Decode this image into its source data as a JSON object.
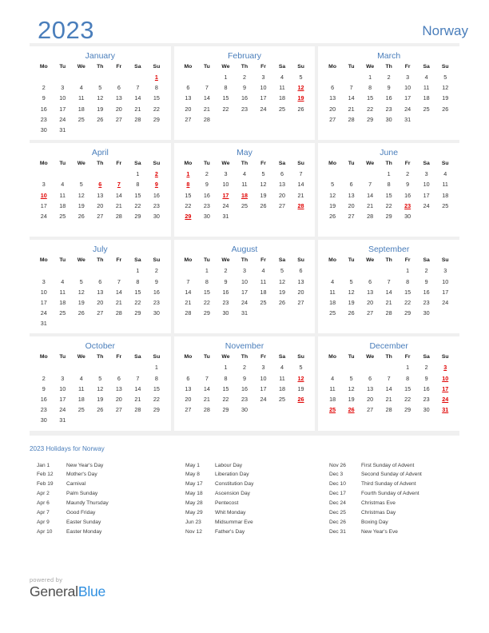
{
  "header": {
    "year": "2023",
    "country": "Norway"
  },
  "months": [
    {
      "name": "January",
      "weekdays": [
        "Mo",
        "Tu",
        "We",
        "Th",
        "Fr",
        "Sa",
        "Su"
      ],
      "weeks": [
        [
          "",
          "",
          "",
          "",
          "",
          "",
          "1"
        ],
        [
          "2",
          "3",
          "4",
          "5",
          "6",
          "7",
          "8"
        ],
        [
          "9",
          "10",
          "11",
          "12",
          "13",
          "14",
          "15"
        ],
        [
          "16",
          "17",
          "18",
          "19",
          "20",
          "21",
          "22"
        ],
        [
          "23",
          "24",
          "25",
          "26",
          "27",
          "28",
          "29"
        ],
        [
          "30",
          "31",
          "",
          "",
          "",
          "",
          ""
        ]
      ],
      "holidays": [
        1
      ]
    },
    {
      "name": "February",
      "weekdays": [
        "Mo",
        "Tu",
        "We",
        "Th",
        "Fr",
        "Sa",
        "Su"
      ],
      "weeks": [
        [
          "",
          "",
          "1",
          "2",
          "3",
          "4",
          "5"
        ],
        [
          "6",
          "7",
          "8",
          "9",
          "10",
          "11",
          "12"
        ],
        [
          "13",
          "14",
          "15",
          "16",
          "17",
          "18",
          "19"
        ],
        [
          "20",
          "21",
          "22",
          "23",
          "24",
          "25",
          "26"
        ],
        [
          "27",
          "28",
          "",
          "",
          "",
          "",
          ""
        ],
        [
          "",
          "",
          "",
          "",
          "",
          "",
          ""
        ]
      ],
      "holidays": [
        12,
        19
      ]
    },
    {
      "name": "March",
      "weekdays": [
        "Mo",
        "Tu",
        "We",
        "Th",
        "Fr",
        "Sa",
        "Su"
      ],
      "weeks": [
        [
          "",
          "",
          "1",
          "2",
          "3",
          "4",
          "5"
        ],
        [
          "6",
          "7",
          "8",
          "9",
          "10",
          "11",
          "12"
        ],
        [
          "13",
          "14",
          "15",
          "16",
          "17",
          "18",
          "19"
        ],
        [
          "20",
          "21",
          "22",
          "23",
          "24",
          "25",
          "26"
        ],
        [
          "27",
          "28",
          "29",
          "30",
          "31",
          "",
          ""
        ],
        [
          "",
          "",
          "",
          "",
          "",
          "",
          ""
        ]
      ],
      "holidays": []
    },
    {
      "name": "April",
      "weekdays": [
        "Mo",
        "Tu",
        "We",
        "Th",
        "Fr",
        "Sa",
        "Su"
      ],
      "weeks": [
        [
          "",
          "",
          "",
          "",
          "",
          "1",
          "2"
        ],
        [
          "3",
          "4",
          "5",
          "6",
          "7",
          "8",
          "9"
        ],
        [
          "10",
          "11",
          "12",
          "13",
          "14",
          "15",
          "16"
        ],
        [
          "17",
          "18",
          "19",
          "20",
          "21",
          "22",
          "23"
        ],
        [
          "24",
          "25",
          "26",
          "27",
          "28",
          "29",
          "30"
        ],
        [
          "",
          "",
          "",
          "",
          "",
          "",
          ""
        ]
      ],
      "holidays": [
        2,
        6,
        7,
        9,
        10
      ]
    },
    {
      "name": "May",
      "weekdays": [
        "Mo",
        "Tu",
        "We",
        "Th",
        "Fr",
        "Sa",
        "Su"
      ],
      "weeks": [
        [
          "1",
          "2",
          "3",
          "4",
          "5",
          "6",
          "7"
        ],
        [
          "8",
          "9",
          "10",
          "11",
          "12",
          "13",
          "14"
        ],
        [
          "15",
          "16",
          "17",
          "18",
          "19",
          "20",
          "21"
        ],
        [
          "22",
          "23",
          "24",
          "25",
          "26",
          "27",
          "28"
        ],
        [
          "29",
          "30",
          "31",
          "",
          "",
          "",
          ""
        ],
        [
          "",
          "",
          "",
          "",
          "",
          "",
          ""
        ]
      ],
      "holidays": [
        1,
        8,
        17,
        18,
        28,
        29
      ]
    },
    {
      "name": "June",
      "weekdays": [
        "Mo",
        "Tu",
        "We",
        "Th",
        "Fr",
        "Sa",
        "Su"
      ],
      "weeks": [
        [
          "",
          "",
          "",
          "1",
          "2",
          "3",
          "4"
        ],
        [
          "5",
          "6",
          "7",
          "8",
          "9",
          "10",
          "11"
        ],
        [
          "12",
          "13",
          "14",
          "15",
          "16",
          "17",
          "18"
        ],
        [
          "19",
          "20",
          "21",
          "22",
          "23",
          "24",
          "25"
        ],
        [
          "26",
          "27",
          "28",
          "29",
          "30",
          "",
          ""
        ],
        [
          "",
          "",
          "",
          "",
          "",
          "",
          ""
        ]
      ],
      "holidays": [
        23
      ]
    },
    {
      "name": "July",
      "weekdays": [
        "Mo",
        "Tu",
        "We",
        "Th",
        "Fr",
        "Sa",
        "Su"
      ],
      "weeks": [
        [
          "",
          "",
          "",
          "",
          "",
          "1",
          "2"
        ],
        [
          "3",
          "4",
          "5",
          "6",
          "7",
          "8",
          "9"
        ],
        [
          "10",
          "11",
          "12",
          "13",
          "14",
          "15",
          "16"
        ],
        [
          "17",
          "18",
          "19",
          "20",
          "21",
          "22",
          "23"
        ],
        [
          "24",
          "25",
          "26",
          "27",
          "28",
          "29",
          "30"
        ],
        [
          "31",
          "",
          "",
          "",
          "",
          "",
          ""
        ]
      ],
      "holidays": []
    },
    {
      "name": "August",
      "weekdays": [
        "Mo",
        "Tu",
        "We",
        "Th",
        "Fr",
        "Sa",
        "Su"
      ],
      "weeks": [
        [
          "",
          "1",
          "2",
          "3",
          "4",
          "5",
          "6"
        ],
        [
          "7",
          "8",
          "9",
          "10",
          "11",
          "12",
          "13"
        ],
        [
          "14",
          "15",
          "16",
          "17",
          "18",
          "19",
          "20"
        ],
        [
          "21",
          "22",
          "23",
          "24",
          "25",
          "26",
          "27"
        ],
        [
          "28",
          "29",
          "30",
          "31",
          "",
          "",
          ""
        ],
        [
          "",
          "",
          "",
          "",
          "",
          "",
          ""
        ]
      ],
      "holidays": []
    },
    {
      "name": "September",
      "weekdays": [
        "Mo",
        "Tu",
        "We",
        "Th",
        "Fr",
        "Sa",
        "Su"
      ],
      "weeks": [
        [
          "",
          "",
          "",
          "",
          "1",
          "2",
          "3"
        ],
        [
          "4",
          "5",
          "6",
          "7",
          "8",
          "9",
          "10"
        ],
        [
          "11",
          "12",
          "13",
          "14",
          "15",
          "16",
          "17"
        ],
        [
          "18",
          "19",
          "20",
          "21",
          "22",
          "23",
          "24"
        ],
        [
          "25",
          "26",
          "27",
          "28",
          "29",
          "30",
          ""
        ],
        [
          "",
          "",
          "",
          "",
          "",
          "",
          ""
        ]
      ],
      "holidays": []
    },
    {
      "name": "October",
      "weekdays": [
        "Mo",
        "Tu",
        "We",
        "Th",
        "Fr",
        "Sa",
        "Su"
      ],
      "weeks": [
        [
          "",
          "",
          "",
          "",
          "",
          "",
          "1"
        ],
        [
          "2",
          "3",
          "4",
          "5",
          "6",
          "7",
          "8"
        ],
        [
          "9",
          "10",
          "11",
          "12",
          "13",
          "14",
          "15"
        ],
        [
          "16",
          "17",
          "18",
          "19",
          "20",
          "21",
          "22"
        ],
        [
          "23",
          "24",
          "25",
          "26",
          "27",
          "28",
          "29"
        ],
        [
          "30",
          "31",
          "",
          "",
          "",
          "",
          ""
        ]
      ],
      "holidays": []
    },
    {
      "name": "November",
      "weekdays": [
        "Mo",
        "Tu",
        "We",
        "Th",
        "Fr",
        "Sa",
        "Su"
      ],
      "weeks": [
        [
          "",
          "",
          "1",
          "2",
          "3",
          "4",
          "5"
        ],
        [
          "6",
          "7",
          "8",
          "9",
          "10",
          "11",
          "12"
        ],
        [
          "13",
          "14",
          "15",
          "16",
          "17",
          "18",
          "19"
        ],
        [
          "20",
          "21",
          "22",
          "23",
          "24",
          "25",
          "26"
        ],
        [
          "27",
          "28",
          "29",
          "30",
          "",
          "",
          ""
        ],
        [
          "",
          "",
          "",
          "",
          "",
          "",
          ""
        ]
      ],
      "holidays": [
        12,
        26
      ]
    },
    {
      "name": "December",
      "weekdays": [
        "Mo",
        "Tu",
        "We",
        "Th",
        "Fr",
        "Sa",
        "Su"
      ],
      "weeks": [
        [
          "",
          "",
          "",
          "",
          "1",
          "2",
          "3"
        ],
        [
          "4",
          "5",
          "6",
          "7",
          "8",
          "9",
          "10"
        ],
        [
          "11",
          "12",
          "13",
          "14",
          "15",
          "16",
          "17"
        ],
        [
          "18",
          "19",
          "20",
          "21",
          "22",
          "23",
          "24"
        ],
        [
          "25",
          "26",
          "27",
          "28",
          "29",
          "30",
          "31"
        ],
        [
          "",
          "",
          "",
          "",
          "",
          "",
          ""
        ]
      ],
      "holidays": [
        3,
        10,
        17,
        24,
        25,
        26,
        31
      ]
    }
  ],
  "holidays_section": {
    "title": "2023 Holidays for Norway",
    "columns": [
      [
        {
          "date": "Jan 1",
          "name": "New Year's Day"
        },
        {
          "date": "Feb 12",
          "name": "Mother's Day"
        },
        {
          "date": "Feb 19",
          "name": "Carnival"
        },
        {
          "date": "Apr 2",
          "name": "Palm Sunday"
        },
        {
          "date": "Apr 6",
          "name": "Maundy Thursday"
        },
        {
          "date": "Apr 7",
          "name": "Good Friday"
        },
        {
          "date": "Apr 9",
          "name": "Easter Sunday"
        },
        {
          "date": "Apr 10",
          "name": "Easter Monday"
        }
      ],
      [
        {
          "date": "May 1",
          "name": "Labour Day"
        },
        {
          "date": "May 8",
          "name": "Liberation Day"
        },
        {
          "date": "May 17",
          "name": "Constitution Day"
        },
        {
          "date": "May 18",
          "name": "Ascension Day"
        },
        {
          "date": "May 28",
          "name": "Pentecost"
        },
        {
          "date": "May 29",
          "name": "Whit Monday"
        },
        {
          "date": "Jun 23",
          "name": "Midsummar Eve"
        },
        {
          "date": "Nov 12",
          "name": "Father's Day"
        }
      ],
      [
        {
          "date": "Nov 26",
          "name": "First Sunday of Advent"
        },
        {
          "date": "Dec 3",
          "name": "Second Sunday of Advent"
        },
        {
          "date": "Dec 10",
          "name": "Third Sunday of Advent"
        },
        {
          "date": "Dec 17",
          "name": "Fourth Sunday of Advent"
        },
        {
          "date": "Dec 24",
          "name": "Christmas Eve"
        },
        {
          "date": "Dec 25",
          "name": "Christmas Day"
        },
        {
          "date": "Dec 26",
          "name": "Boxing Day"
        },
        {
          "date": "Dec 31",
          "name": "New Year's Eve"
        }
      ]
    ]
  },
  "footer": {
    "powered_by": "powered by",
    "brand_first": "General",
    "brand_second": "Blue"
  },
  "colors": {
    "accent_blue": "#4a7ebb",
    "holiday_red": "#e00000",
    "panel_gray": "#f0f0f0",
    "brand_blue": "#2f8fe0"
  }
}
